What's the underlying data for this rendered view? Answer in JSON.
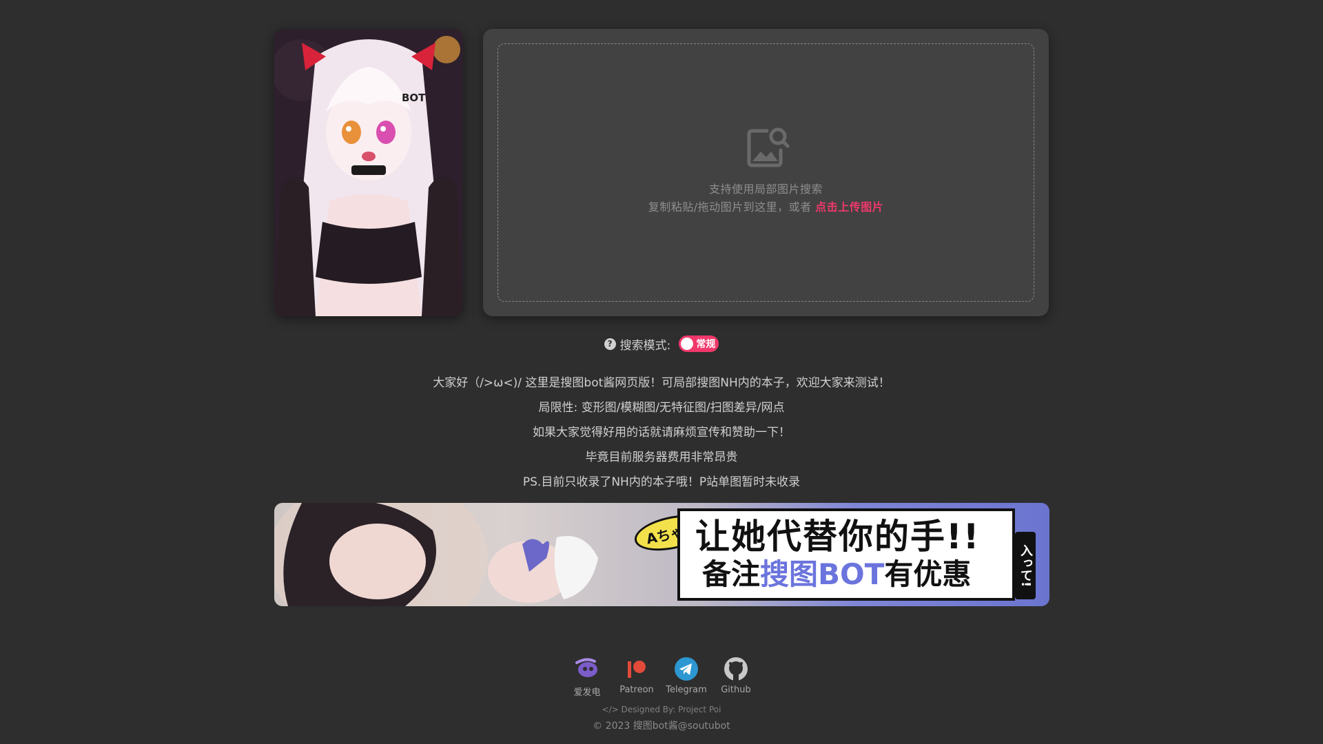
{
  "upload": {
    "line1": "支持使用局部图片搜索",
    "line2_prefix": "复制粘贴/拖动图片到这里，或者",
    "link": "点击上传图片"
  },
  "mode": {
    "help": "?",
    "label": "搜索模式:",
    "value": "常规",
    "enabled": true
  },
  "intro": [
    "大家好（/>ω<)/ 这里是搜图bot酱网页版！可局部搜图NH内的本子，欢迎大家来测试！",
    "局限性: 变形图/模糊图/无特征图/扫图差异/网点",
    "如果大家觉得好用的话就请麻烦宣传和赞助一下！",
    "毕竟目前服务器费用非常昂贵",
    "PS.目前只收录了NH内的本子哦！P站单图暂时未收录"
  ],
  "banner": {
    "tag": "Aちゃん",
    "line1": "让她代替你的手!!",
    "line2_prefix": "备注",
    "line2_highlight": "搜图BOT",
    "line2_suffix": "有优惠",
    "side": "入って!"
  },
  "mascot": {
    "badge": "BOT"
  },
  "social": [
    {
      "label": "爱发电",
      "icon": "afdian-icon",
      "color": "#7b5cc9"
    },
    {
      "label": "Patreon",
      "icon": "patreon-icon",
      "color": "#e24a3a"
    },
    {
      "label": "Telegram",
      "icon": "telegram-icon",
      "color": "#2d97d1"
    },
    {
      "label": "Github",
      "icon": "github-icon",
      "color": "#c8c8c8"
    }
  ],
  "footer": {
    "designed": "</> Designed By: Project Poi",
    "copyright": "© 2023 搜图bot酱@soutubot"
  },
  "colors": {
    "background": "#2e2e2e",
    "card": "#424242",
    "accent": "#f0386b"
  }
}
